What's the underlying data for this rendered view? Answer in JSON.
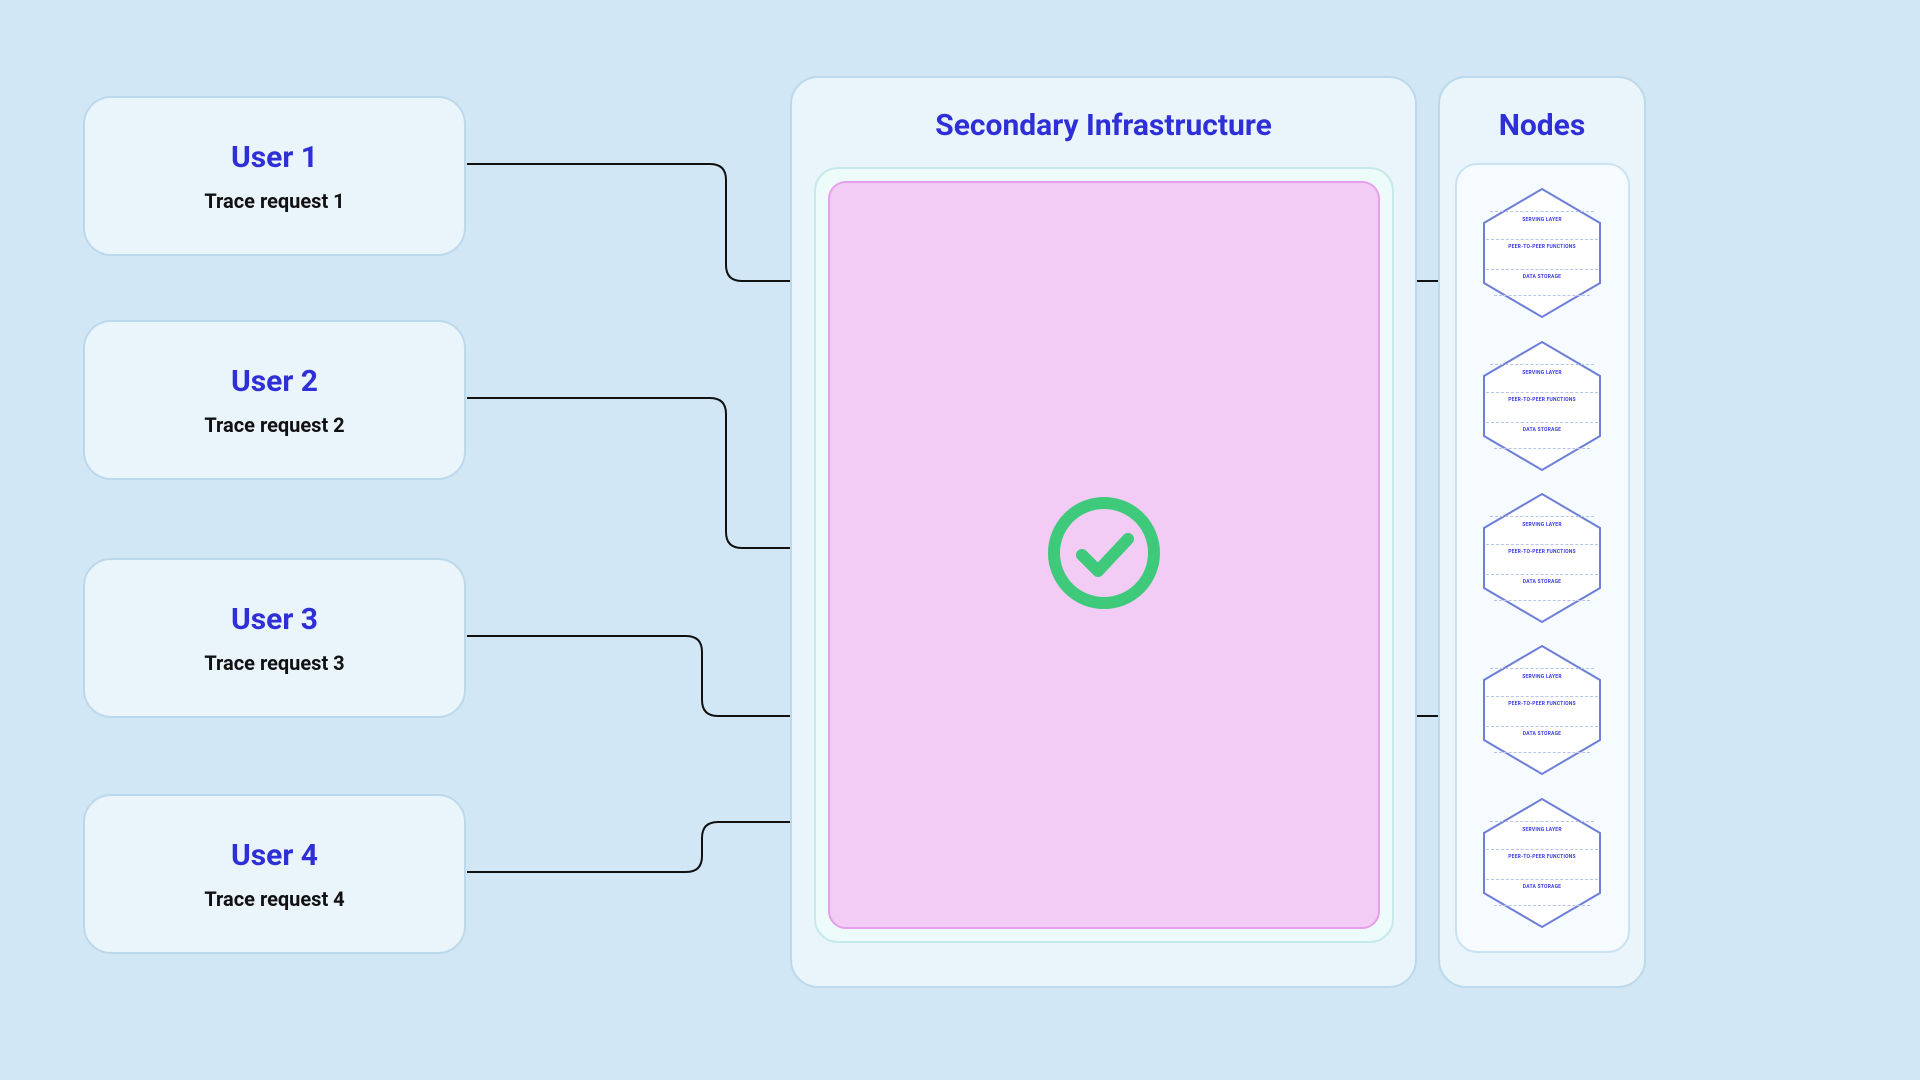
{
  "colors": {
    "background": "#d1e7f5",
    "card_bg": "#e9f4fb",
    "card_border": "#bcd9ec",
    "title": "#2f2fd7",
    "inner_teal_bg": "#eefbfb",
    "inner_teal_border": "#c7e9e9",
    "pink_bg": "#f3ccf6",
    "pink_border": "#e59fec",
    "check_green": "#3fc97b",
    "node_hex_border": "#6f7ed6"
  },
  "users": [
    {
      "title": "User 1",
      "subtitle": "Trace request 1"
    },
    {
      "title": "User 2",
      "subtitle": "Trace request 2"
    },
    {
      "title": "User 3",
      "subtitle": "Trace request 3"
    },
    {
      "title": "User 4",
      "subtitle": "Trace request 4"
    }
  ],
  "infrastructure": {
    "title": "Secondary Infrastructure",
    "status_icon": "check-circle-icon"
  },
  "nodes": {
    "title": "Nodes",
    "count": 5,
    "hex_labels": {
      "serving": "SERVING LAYER",
      "p2p": "PEER-TO-PEER FUNCTIONS",
      "storage": "DATA STORAGE"
    }
  },
  "connectors": [
    {
      "from": "user-1",
      "to": "node-1"
    },
    {
      "from": "user-2",
      "to": "infrastructure-center"
    },
    {
      "from": "user-3",
      "to": "node-4"
    },
    {
      "from": "user-4",
      "to": "infrastructure-lower"
    }
  ]
}
